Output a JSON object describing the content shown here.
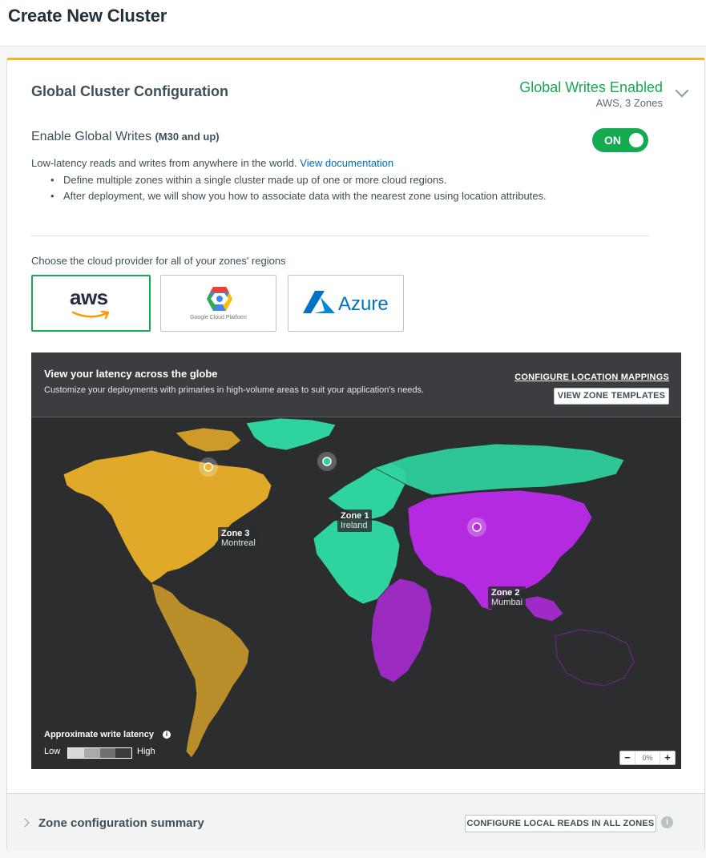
{
  "page": {
    "title": "Create New Cluster"
  },
  "config": {
    "title": "Global Cluster Configuration",
    "status": "Global Writes Enabled",
    "status_sub": "AWS, 3 Zones",
    "enable_label": "Enable Global Writes",
    "enable_note": "(M30 and up)",
    "toggle_label": "ON",
    "description": "Low-latency reads and writes from anywhere in the world.",
    "doc_link": "View documentation",
    "bullets": [
      "Define multiple zones within a single cluster made up of one or more cloud regions.",
      "After deployment, we will show you how to associate data with the nearest zone using location attributes."
    ]
  },
  "providers": {
    "prompt": "Choose the cloud provider for all of your zones' regions",
    "items": [
      {
        "id": "aws",
        "label": "aws",
        "selected": true
      },
      {
        "id": "gcp",
        "label": "Google Cloud Platform",
        "selected": false
      },
      {
        "id": "azure",
        "label": "Azure",
        "selected": false
      }
    ]
  },
  "map": {
    "title": "View your latency across the globe",
    "subtitle": "Customize your deployments with primaries in high-volume areas to suit your application's needs.",
    "configure_link": "CONFIGURE LOCATION MAPPINGS",
    "templates_button": "VIEW ZONE TEMPLATES",
    "zones": [
      {
        "name": "Zone 1",
        "city": "Ireland",
        "color": "#2fd3a0"
      },
      {
        "name": "Zone 2",
        "city": "Mumbai",
        "color": "#b42ae0"
      },
      {
        "name": "Zone 3",
        "city": "Montreal",
        "color": "#f0b429"
      }
    ],
    "legend_title": "Approximate write latency",
    "legend_low": "Low",
    "legend_high": "High",
    "zoom_value": "0%"
  },
  "summary": {
    "title": "Zone configuration summary",
    "button": "CONFIGURE LOCAL READS IN ALL ZONES"
  }
}
